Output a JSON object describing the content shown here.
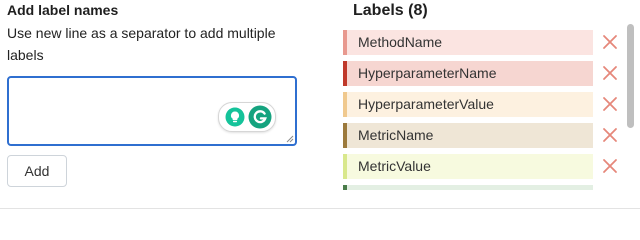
{
  "add_form": {
    "title": "Add label names",
    "description": "Use new line as a separator to add multiple labels",
    "textarea_value": "",
    "add_label": "Add"
  },
  "labels_panel": {
    "title": "Labels (8)",
    "items": [
      {
        "label": "MethodName",
        "color": "#e8998f",
        "background": "#fbe4e1"
      },
      {
        "label": "HyperparameterName",
        "color": "#c0392b",
        "background": "#f6d6d1"
      },
      {
        "label": "HyperparameterValue",
        "color": "#f0c98e",
        "background": "#fdf1e0"
      },
      {
        "label": "MetricName",
        "color": "#9c7a3c",
        "background": "#efe6d6"
      },
      {
        "label": "MetricValue",
        "color": "#d9e88c",
        "background": "#f7fadf"
      },
      {
        "label": "",
        "color": "#4a7c4a",
        "background": "#e3efe3"
      }
    ],
    "remove_icon": "close-x-icon",
    "remove_color": "#e6877a"
  },
  "extensions": {
    "bulb_icon": "lightbulb-icon",
    "grammarly_icon": "grammarly-icon",
    "accent": "#15c39a"
  }
}
